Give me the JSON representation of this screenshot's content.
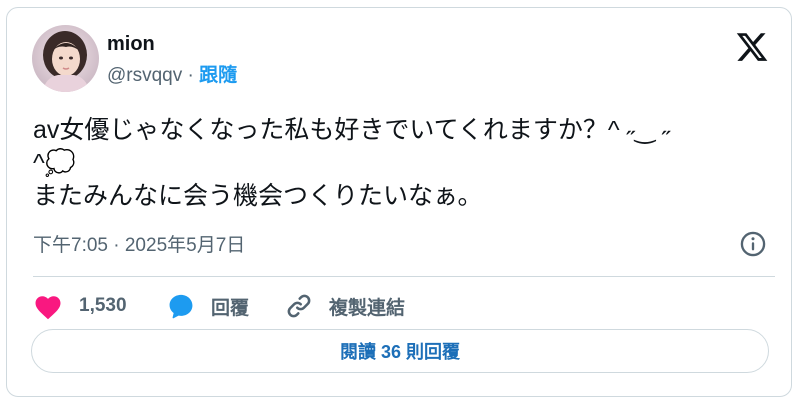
{
  "author": {
    "name": "mion",
    "handle": "@rsvqqv",
    "separator": " · ",
    "follow_label": "跟隨"
  },
  "tweet": {
    "text": "av女優じゃなくなった私も好きでいてくれますか？^ ˶‿ ˶\n^💭\nまたみんなに会う機会つくりたいなぁ。",
    "timestamp": "下午7:05 · 2025年5月7日"
  },
  "actions": {
    "like_count": "1,530",
    "reply_label": "回覆",
    "copy_link_label": "複製連結"
  },
  "footer": {
    "read_replies_label": "閱讀 36 則回覆"
  },
  "colors": {
    "like": "#f91880",
    "reply": "#1d9bf0",
    "link": "#1d9bf0",
    "muted": "#536471",
    "border": "#cfd9de"
  },
  "icons": {
    "logo": "x-logo-icon",
    "info": "info-icon",
    "like": "heart-icon",
    "reply": "reply-bubble-icon",
    "copy": "link-icon"
  }
}
